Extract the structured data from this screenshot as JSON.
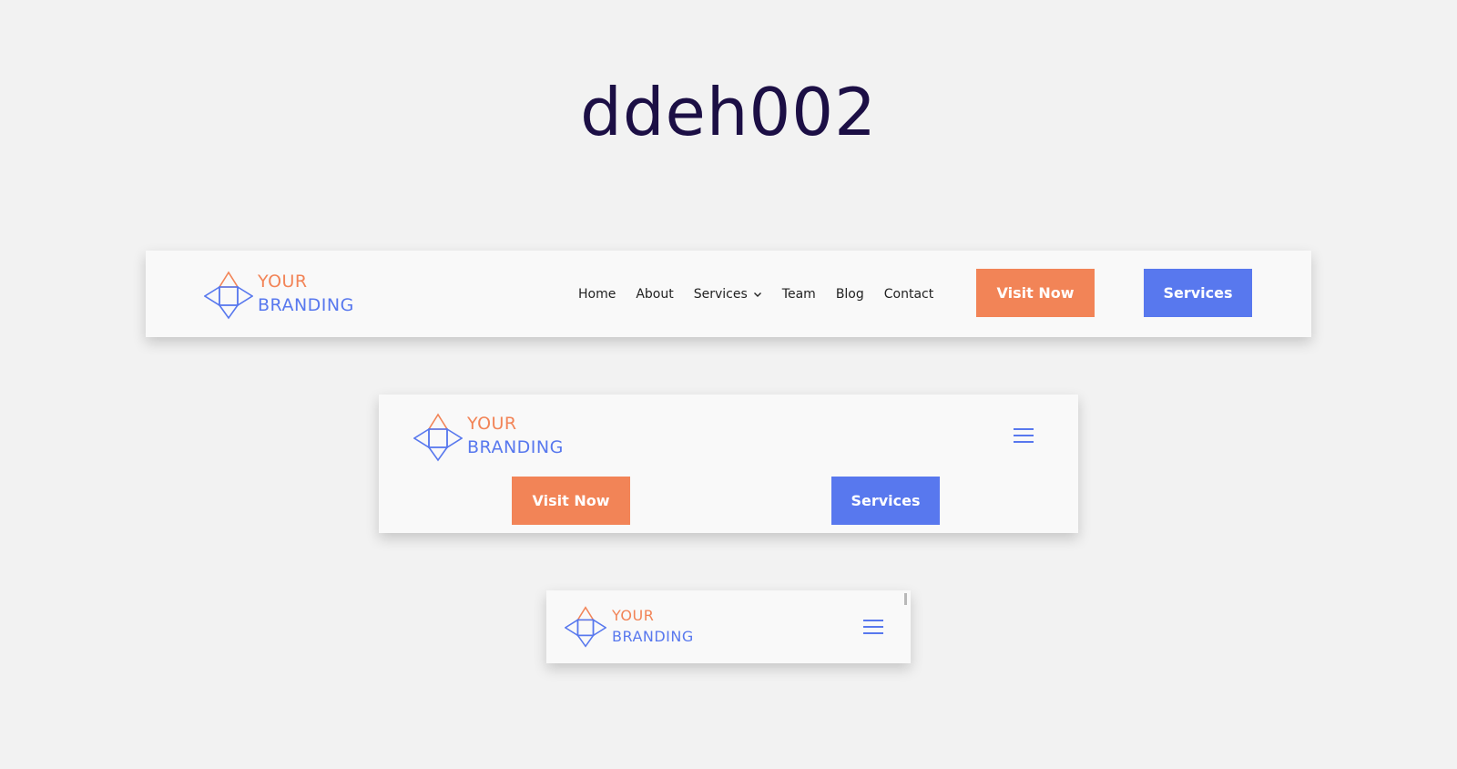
{
  "page": {
    "title": "ddeh002"
  },
  "logo": {
    "line1": "YOUR",
    "line2": "BRANDING",
    "colors": {
      "orange": "#f28457",
      "blue": "#5878ee"
    }
  },
  "desktop": {
    "nav": [
      "Home",
      "About",
      "Services",
      "Team",
      "Blog",
      "Contact"
    ],
    "services_dropdown_icon": "chevron-down-icon",
    "buttons": {
      "primary": "Visit Now",
      "secondary": "Services"
    }
  },
  "tablet": {
    "menu_icon": "hamburger-menu-icon",
    "buttons": {
      "primary": "Visit Now",
      "secondary": "Services"
    }
  },
  "mobile": {
    "menu_icon": "hamburger-menu-icon"
  },
  "colors": {
    "background": "#f2f2f2",
    "header_bg": "#f9f9f9",
    "title": "#1c0f45",
    "accent_orange": "#f28457",
    "accent_blue": "#5878ee",
    "nav_text": "#222222"
  }
}
